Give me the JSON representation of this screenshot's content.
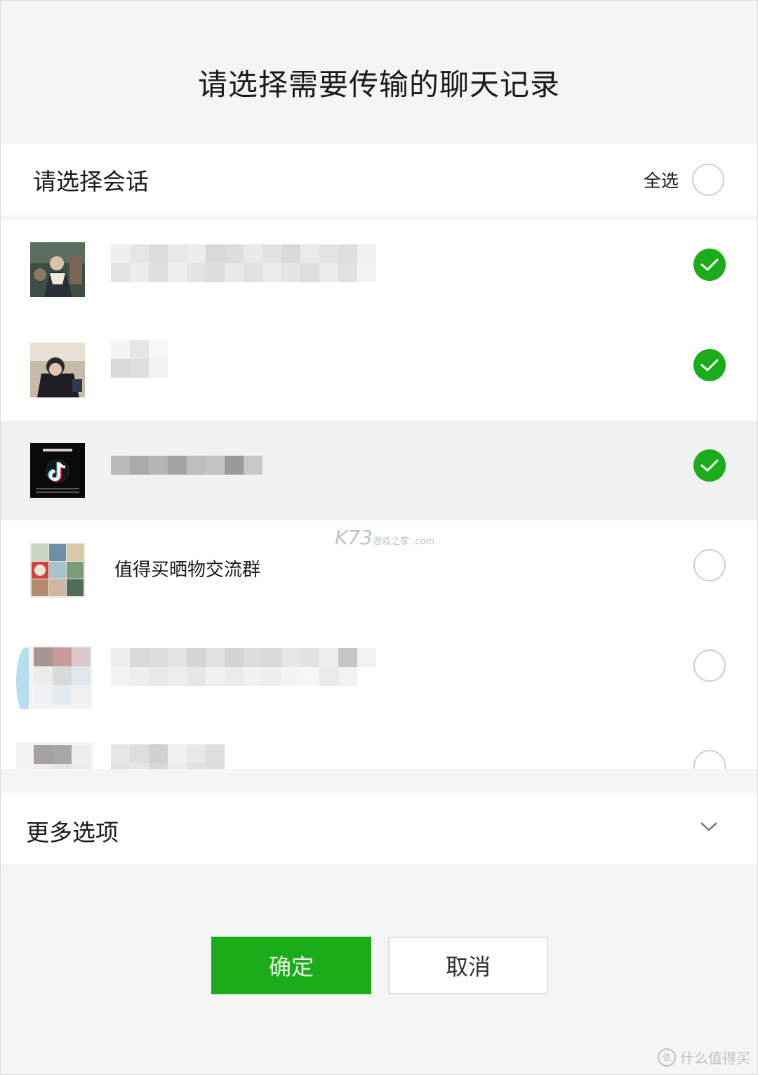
{
  "dialog": {
    "title": "请选择需要传输的聊天记录",
    "header": {
      "label": "请选择会话",
      "select_all": "全选"
    },
    "chats": [
      {
        "name": "",
        "selected": true
      },
      {
        "name": "",
        "selected": true
      },
      {
        "name": "",
        "selected": true,
        "highlighted": true
      },
      {
        "name": "值得买晒物交流群",
        "selected": false
      },
      {
        "name": "",
        "selected": false
      },
      {
        "name": "",
        "selected": false
      }
    ],
    "more_options": "更多选项",
    "buttons": {
      "confirm": "确定",
      "cancel": "取消"
    }
  },
  "watermark": {
    "main": "K73",
    "sub": "游戏之家 .com"
  },
  "corner_watermark": {
    "badge": "值",
    "text": "什么值得买"
  },
  "colors": {
    "accent": "#1aad19",
    "background": "#f5f5f5",
    "highlight": "#f1f1f1"
  }
}
